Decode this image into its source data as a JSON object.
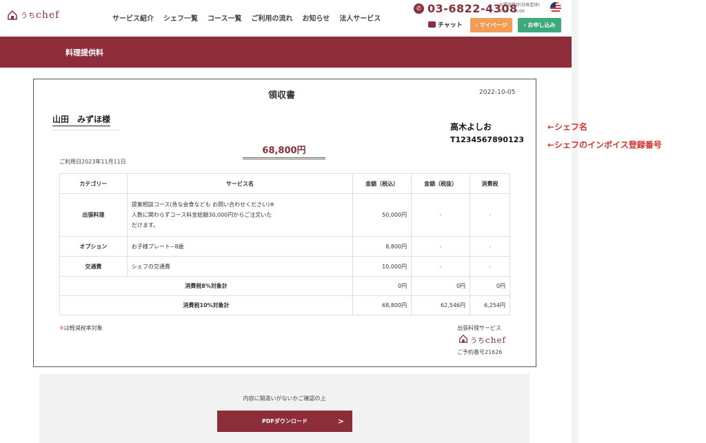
{
  "header": {
    "logo_small": "うち",
    "logo_main": "chef",
    "nav": [
      "サービス紹介",
      "シェフ一覧",
      "コース一覧",
      "ご利用の流れ",
      "お知らせ",
      "法人サービス"
    ],
    "phone": "03-6822-4308",
    "phone_hours_line1": "お電話受付(日祝定休)",
    "phone_hours_line2": "9:00〜18:00",
    "chat_label": "チャット",
    "mypage_label": "› マイページ",
    "apply_label": "› お申し込み"
  },
  "banner": {
    "title": "料理提供料"
  },
  "receipt": {
    "title": "領収書",
    "date": "2022-10-05",
    "customer": "山田　みずほ様",
    "chef_name": "高木よしお",
    "invoice_number": "T1234567890123",
    "amount": "68,800円",
    "usage_date": "ご利用日2023年11月11日",
    "columns": [
      "カテゴリー",
      "サービス名",
      "金額（税込）",
      "金額（税抜）",
      "消費税"
    ],
    "rows": [
      {
        "category": "出張料理",
        "service_lines": [
          "提案相談コース(急な会食なども お問い合わせください)※",
          "人数に関わらずコース料金総額30,000円からご注文いた",
          "だけます。"
        ],
        "incl": "50,000円",
        "excl": "-",
        "tax": "-"
      },
      {
        "category": "オプション",
        "service": "お子様プレート~8歳",
        "incl": "8,800円",
        "excl": "-",
        "tax": "-"
      },
      {
        "category": "交通費",
        "service": "シェフの交通費",
        "incl": "10,000円",
        "excl": "-",
        "tax": "-"
      }
    ],
    "summary": [
      {
        "label": "消費税8%対象計",
        "incl": "0円",
        "excl": "0円",
        "tax": "0円"
      },
      {
        "label": "消費税10%対象計",
        "incl": "68,800円",
        "excl": "62,546円",
        "tax": "6,254円"
      }
    ],
    "note_mark": "※",
    "note_text": "は軽減税率対象",
    "service_name": "出張料理サービス",
    "booking_number": "ご予約番号21626"
  },
  "annotations": {
    "chef_name": "←シェフ名",
    "invoice": "←シェフのインボイス登録番号"
  },
  "confirm": {
    "text": "内容に間違いがないかご確認の上",
    "pdf_button": "PDFダウンロード",
    "pdf_chevron": ">"
  },
  "colors": {
    "brand": "#8d2d3a",
    "mypage": "#f29c54",
    "apply": "#3daa7c",
    "annotation": "#d9302c"
  }
}
